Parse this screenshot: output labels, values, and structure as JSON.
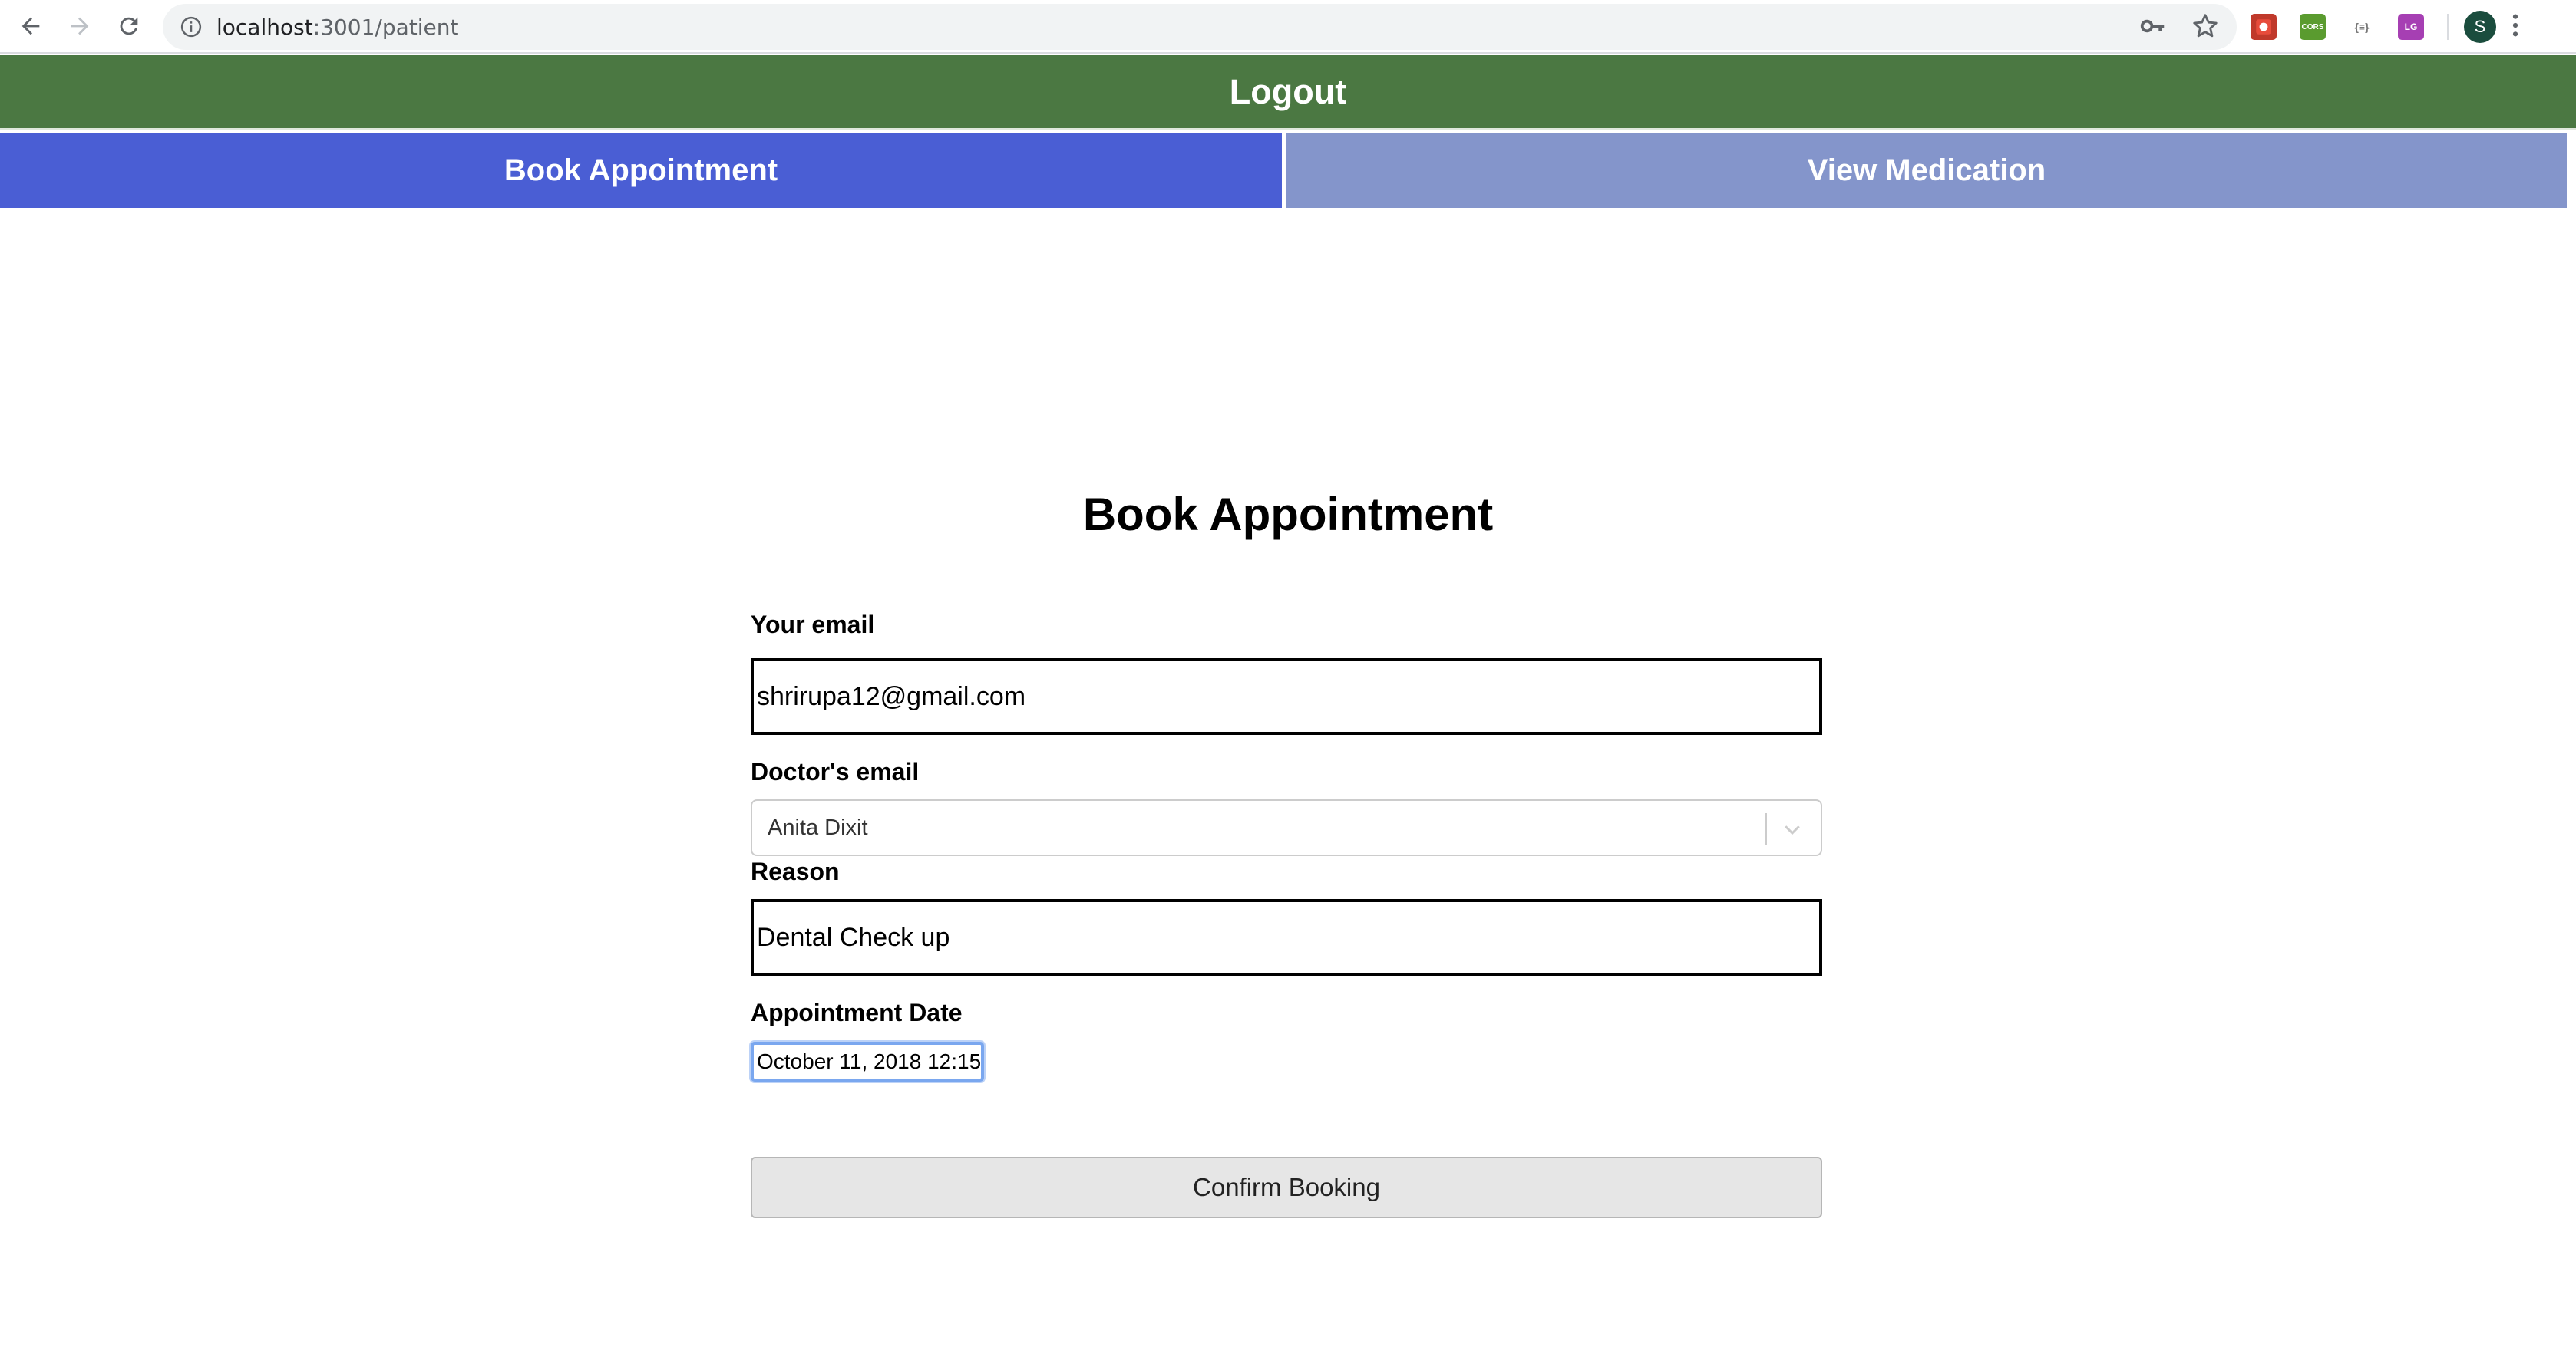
{
  "browser": {
    "url_host": "localhost",
    "url_path": ":3001/patient",
    "icons": [
      "back-arrow-icon",
      "forward-arrow-icon",
      "reload-icon",
      "info-icon",
      "key-icon",
      "star-icon",
      "menu-dots-icon"
    ],
    "extensions": [
      {
        "name": "ext-red-icon",
        "label": "",
        "color": "#c0392b"
      },
      {
        "name": "ext-cors-icon",
        "label": "CORS",
        "color": "#5a9b2f"
      },
      {
        "name": "ext-json-icon",
        "label": "{≡}",
        "color": "#ffffff"
      },
      {
        "name": "ext-lg-icon",
        "label": "LG",
        "color": "#a63fb3"
      }
    ],
    "avatar_initial": "S"
  },
  "header": {
    "logout_label": "Logout",
    "color": "#4b7842"
  },
  "tabs": {
    "book_label": "Book Appointment",
    "view_label": "View Medication",
    "active_color": "#4a5ed4",
    "inactive_color": "#8495cb"
  },
  "form": {
    "title": "Book Appointment",
    "email_label": "Your email",
    "email_value": "shrirupa12@gmail.com",
    "doctor_label": "Doctor's email",
    "doctor_value": "Anita Dixit",
    "reason_label": "Reason",
    "reason_value": "Dental Check up",
    "date_label": "Appointment Date",
    "date_value": "October 11, 2018 12:15",
    "confirm_label": "Confirm Booking"
  }
}
